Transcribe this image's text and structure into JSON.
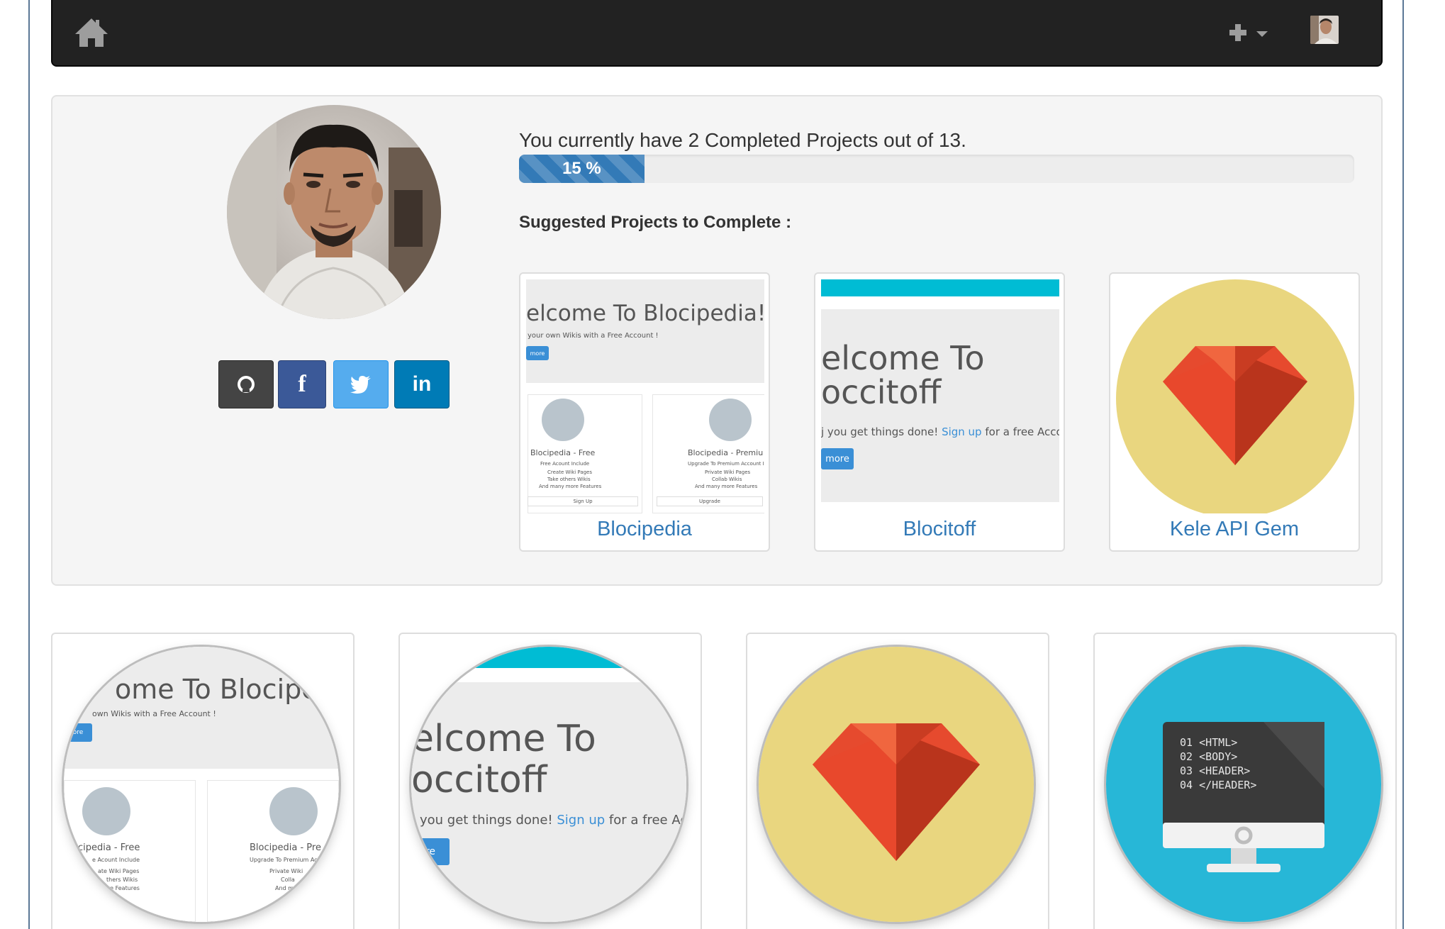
{
  "navbar": {
    "home_icon": "home-icon",
    "add_icon": "plus-icon",
    "caret_icon": "caret-down-icon",
    "avatar_icon": "user-avatar"
  },
  "profile": {
    "completion_text": "You currently have 2 Completed Projects out of 13.",
    "progress_percent": 15,
    "progress_label": "15 %",
    "suggested_title": "Suggested Projects to Complete :",
    "social": [
      "github-icon",
      "facebook-icon",
      "twitter-icon",
      "linkedin-icon"
    ],
    "social_labels": {
      "facebook": "f",
      "linkedin": "in"
    }
  },
  "suggested_projects": [
    {
      "caption": "Blocipedia",
      "preview": {
        "hero_title": "elcome To Blocipedia!",
        "hero_sub": "your own Wikis with a Free Account !",
        "hero_btn": "more",
        "col1_title": "Blocipedia - Free",
        "col1_sub": "Free Acount Include",
        "col1_items": [
          "Create Wiki Pages",
          "Take others Wikis",
          "And many more Features"
        ],
        "col1_btn": "Sign Up",
        "col2_title": "Blocipedia - Premiu",
        "col2_sub": "Upgrade To Premium Account Inc",
        "col2_items": [
          "Private Wiki Pages",
          "Collab Wikis",
          "And many more Features"
        ],
        "col2_btn": "Upgrade"
      }
    },
    {
      "caption": "Blocitoff",
      "preview": {
        "hero_title_1": "elcome To",
        "hero_title_2": "occitoff",
        "hero_sub_1": "j you get things done!",
        "hero_sub_link": "Sign up",
        "hero_sub_2": "for a free Accour",
        "hero_btn": "more"
      }
    },
    {
      "caption": "Kele API Gem",
      "preview": {
        "icon": "ruby-gem-icon"
      }
    }
  ],
  "all_projects": [
    {
      "preview": {
        "hero_title": "ome To Blocipedi",
        "hero_sub": "own Wikis with a Free Account !",
        "hero_btn": "ore",
        "col1_title": "ocipedia - Free",
        "col1_sub": "e Acount Include",
        "col1_items": [
          "ate Wiki Pages",
          "thers Wikis",
          "re Features"
        ],
        "col2_title": "Blocipedia - Pre",
        "col2_sub": "Upgrade To Premium Acc",
        "col2_items": [
          "Private Wiki",
          "Colla",
          "And ma"
        ]
      }
    },
    {
      "preview": {
        "hero_title_1": "elcome To",
        "hero_title_2": "occitoff",
        "hero_sub_1": "you get things done!",
        "hero_sub_link": "Sign up",
        "hero_sub_2": "for a free Accou",
        "hero_btn": "re"
      }
    },
    {
      "preview": {
        "icon": "ruby-gem-icon"
      }
    },
    {
      "preview": {
        "icon": "monitor-code-icon",
        "code_lines": [
          "01 <HTML>",
          "02 <BODY>",
          "03 <HEADER>",
          "04 </HEADER>"
        ]
      }
    }
  ],
  "colors": {
    "navbar": "#222222",
    "well": "#f5f5f5",
    "link": "#337ab7",
    "progress": "#337ab7",
    "github": "#444444",
    "facebook": "#3b5998",
    "twitter": "#55acee",
    "linkedin": "#007bb6",
    "ruby_bg": "#e9d67f",
    "ruby": "#e64a2e",
    "monitor_bg": "#27b7d7"
  }
}
